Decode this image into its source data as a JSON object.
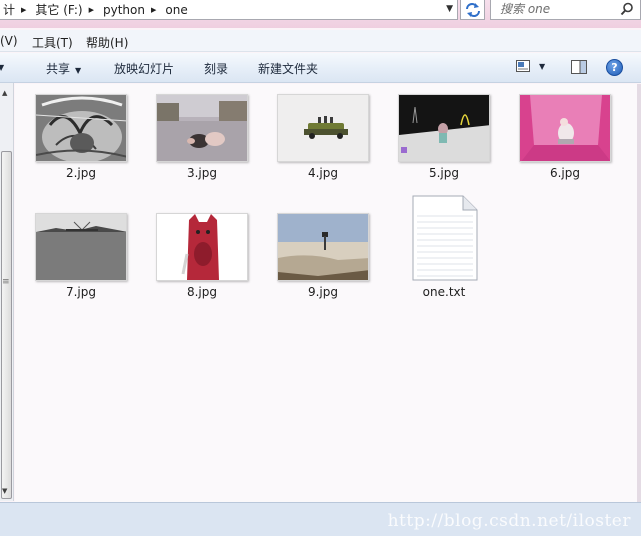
{
  "address_bar": {
    "crumbs": [
      "计",
      "其它 (F:)",
      "python",
      "one"
    ],
    "search_placeholder": "搜索 one"
  },
  "menu": {
    "items": [
      "(V)",
      "工具(T)",
      "帮助(H)"
    ]
  },
  "commands": {
    "share": "共享",
    "slideshow": "放映幻灯片",
    "burn": "刻录",
    "new_folder": "新建文件夹",
    "help": "?"
  },
  "files": [
    {
      "name": "2.jpg",
      "thumb": "bw-texture"
    },
    {
      "name": "3.jpg",
      "thumb": "pigs-on-road"
    },
    {
      "name": "4.jpg",
      "thumb": "car-on-white"
    },
    {
      "name": "5.jpg",
      "thumb": "dark-figures"
    },
    {
      "name": "6.jpg",
      "thumb": "pink-room"
    },
    {
      "name": "7.jpg",
      "thumb": "gray-landscape"
    },
    {
      "name": "8.jpg",
      "thumb": "red-creature"
    },
    {
      "name": "9.jpg",
      "thumb": "desert-person"
    },
    {
      "name": "one.txt",
      "thumb": "text-file-icon"
    }
  ],
  "watermark": "http://blog.csdn.net/iloster",
  "colors": {
    "address_bar_bg": "#efcfe0",
    "command_bar_bg": "#dbe6f3",
    "status_bar_bg": "#dbe5f2",
    "help_blue": "#1d5cb8"
  }
}
